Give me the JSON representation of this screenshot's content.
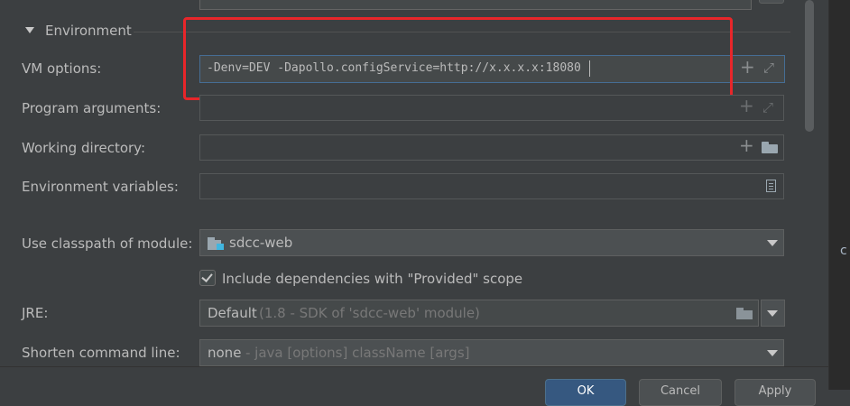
{
  "section": {
    "title": "Environment"
  },
  "vm_options": {
    "label": "VM options:",
    "value": "-Denv=DEV -Dapollo.configService=http://x.x.x.x:18080"
  },
  "program_arguments": {
    "label": "Program arguments:",
    "value": ""
  },
  "working_directory": {
    "label": "Working directory:",
    "value": ""
  },
  "environment_variables": {
    "label": "Environment variables:",
    "value": ""
  },
  "classpath_module": {
    "label": "Use classpath of module:",
    "value": "sdcc-web"
  },
  "include_dependencies": {
    "label": "Include dependencies with \"Provided\" scope",
    "checked": true
  },
  "jre": {
    "label": "JRE:",
    "value": "Default",
    "hint": "(1.8 - SDK of 'sdcc-web' module)"
  },
  "shorten_command_line": {
    "label": "Shorten command line:",
    "value": "none",
    "hint": "- java [options] className [args]"
  },
  "right_panel": {
    "text": "c"
  },
  "footer": {
    "ok_label": "OK",
    "cancel_label": "Cancel",
    "apply_label": "Apply"
  },
  "annotation": {
    "color": "#e8262a"
  },
  "icons": [
    "collapse-triangle-icon",
    "plus-icon",
    "expand-icon",
    "folder-icon",
    "document-icon",
    "module-folder-icon",
    "chevron-down-icon",
    "checkbox-checked-icon"
  ]
}
